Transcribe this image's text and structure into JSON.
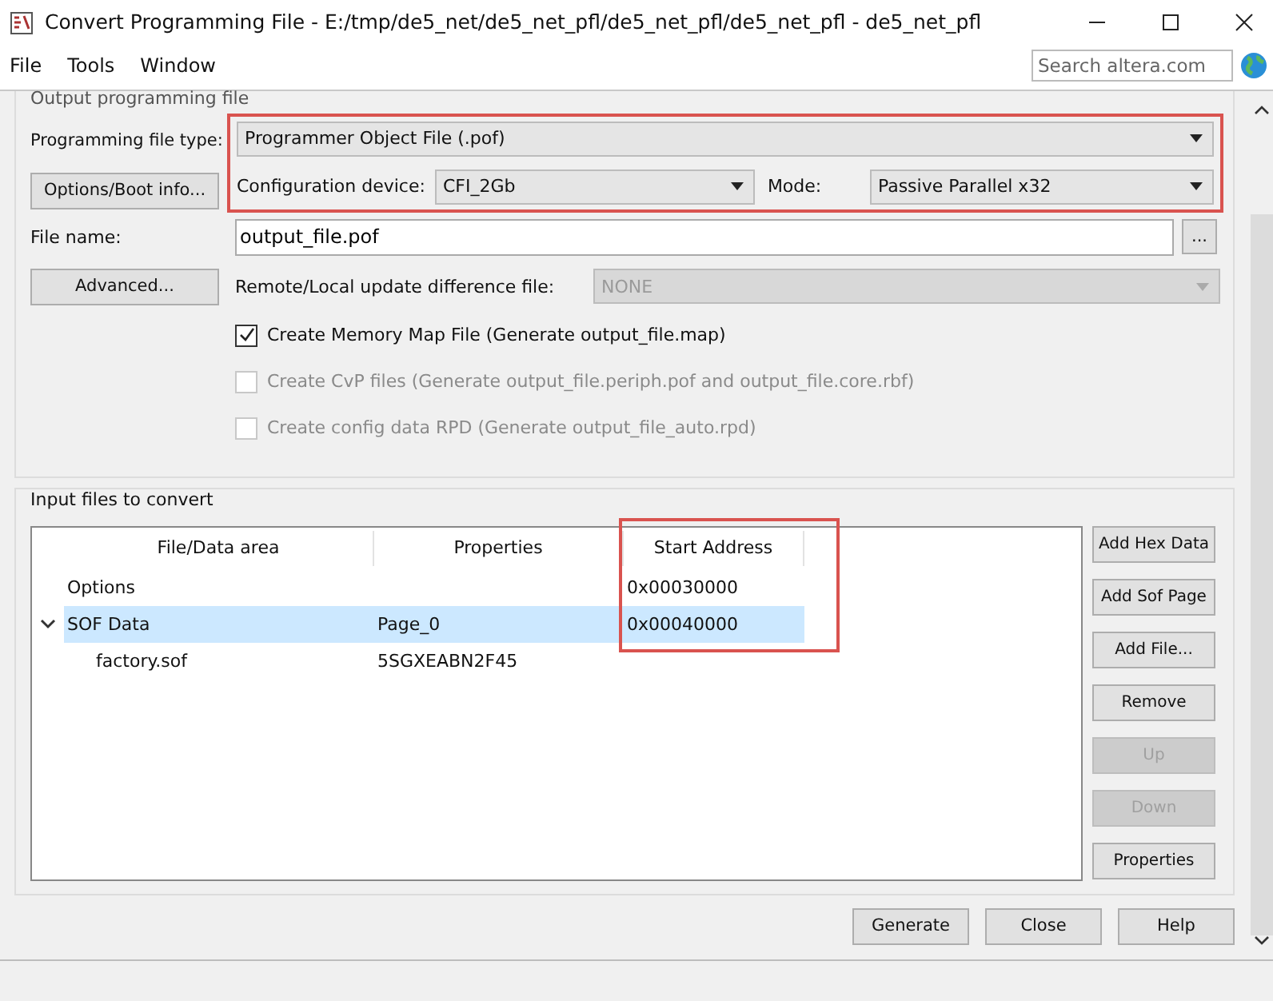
{
  "window": {
    "title": "Convert Programming File - E:/tmp/de5_net/de5_net_pfl/de5_net_pfl/de5_net_pfl - de5_net_pfl"
  },
  "menu": [
    "File",
    "Tools",
    "Window"
  ],
  "search": {
    "placeholder": "Search altera.com"
  },
  "output_group": {
    "title": "Output programming file",
    "highlighted": true,
    "file_type_label": "Programming file type:",
    "file_type": "Programmer Object File (.pof)",
    "options_button": "Options/Boot info...",
    "config_label": "Configuration device:",
    "config_device": "CFI_2Gb",
    "mode_label": "Mode:",
    "mode": "Passive Parallel x32",
    "file_name_label": "File name:",
    "file_name": "output_file.pof",
    "browse_button": "...",
    "advanced_button": "Advanced...",
    "remote_label": "Remote/Local update difference file:",
    "remote_value": "NONE",
    "remote_disabled": true,
    "checks": [
      {
        "label": "Create Memory Map File (Generate output_file.map)",
        "checked": true,
        "disabled": false
      },
      {
        "label": "Create CvP files (Generate output_file.periph.pof and output_file.core.rbf)",
        "checked": false,
        "disabled": true
      },
      {
        "label": "Create config data RPD (Generate output_file_auto.rpd)",
        "checked": false,
        "disabled": true
      }
    ]
  },
  "input_group": {
    "title": "Input files to convert",
    "columns": [
      {
        "label": "File/Data area",
        "highlighted": false
      },
      {
        "label": "Properties",
        "highlighted": false
      },
      {
        "label": "Start Address",
        "highlighted": true
      }
    ],
    "rows": [
      {
        "cells": [
          "Options",
          "",
          "0x00030000"
        ],
        "selected": false,
        "expanded": null,
        "children": []
      },
      {
        "cells": [
          "SOF Data",
          "Page_0",
          "0x00040000"
        ],
        "selected": true,
        "expanded": true,
        "children": [
          {
            "cells": [
              "factory.sof",
              "5SGXEABN2F45",
              ""
            ]
          }
        ]
      }
    ],
    "buttons": [
      {
        "label": "Add Hex Data",
        "disabled": false
      },
      {
        "label": "Add Sof Page",
        "disabled": false
      },
      {
        "label": "Add File...",
        "disabled": false
      },
      {
        "label": "Remove",
        "disabled": false
      },
      {
        "label": "Up",
        "disabled": true
      },
      {
        "label": "Down",
        "disabled": true
      },
      {
        "label": "Properties",
        "disabled": false
      }
    ]
  },
  "footer_buttons": [
    "Generate",
    "Close",
    "Help"
  ]
}
